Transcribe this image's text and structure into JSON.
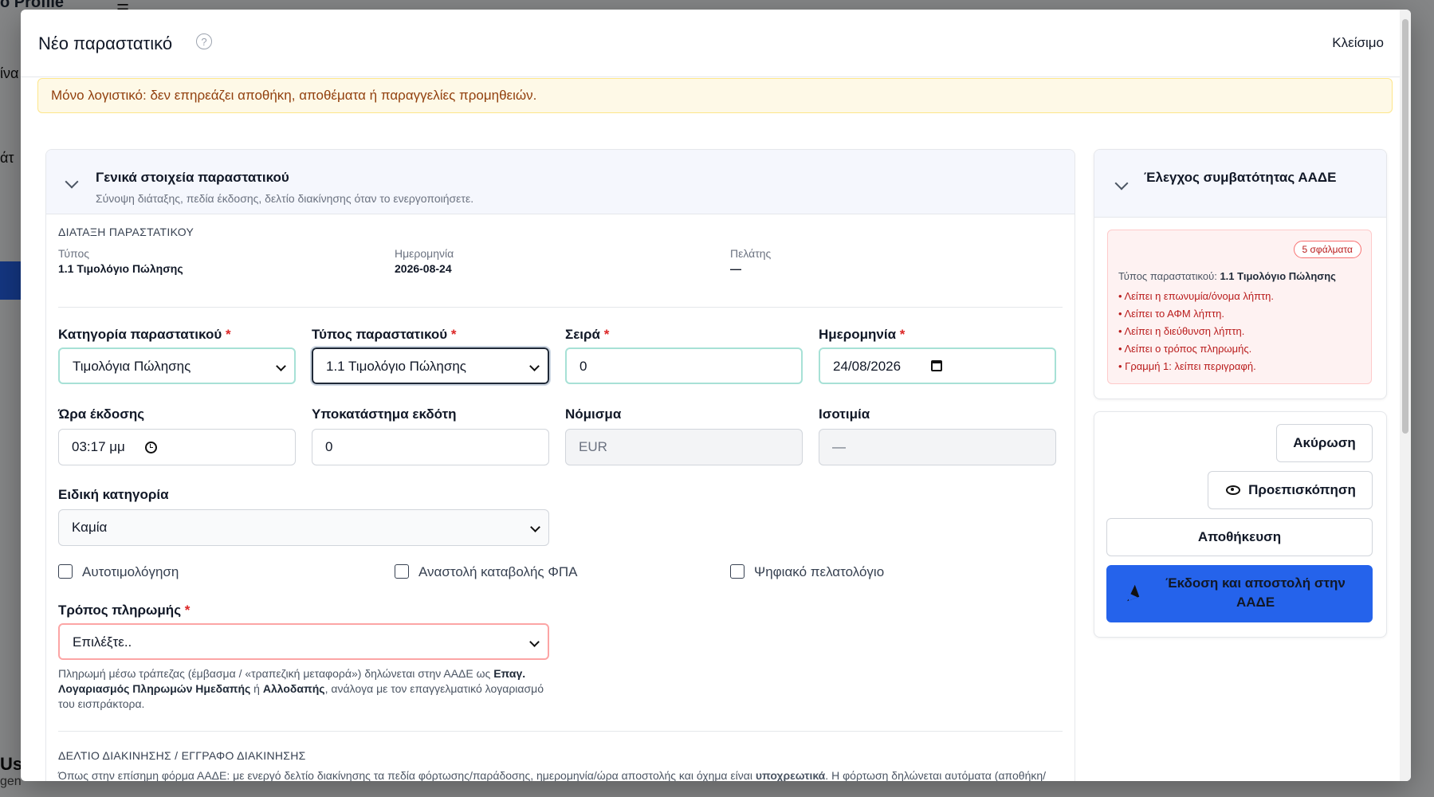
{
  "background": {
    "app_title": "o Profile",
    "sidebar_fragments": [
      "ίνα",
      "άτ"
    ],
    "bottom_user": "Use",
    "bottom_sub": "gen"
  },
  "modal": {
    "title": "Νέο παραστατικό",
    "help_icon": "?",
    "close_label": "Κλείσιμο",
    "alert_text": "Μόνο λογιστικό: δεν επηρεάζει αποθήκη, αποθέματα ή παραγγελίες προμηθειών."
  },
  "general": {
    "title": "Γενικά στοιχεία παραστατικού",
    "subtitle": "Σύνοψη διάταξης, πεδία έκδοσης, δελτίο διακίνησης όταν το ενεργοποιήσετε.",
    "section_label": "ΔΙΑΤΑΞΗ ΠΑΡΑΣΤΑΤΙΚΟΥ",
    "summary": {
      "type_label": "Τύπος",
      "type_value": "1.1 Τιμολόγιο Πώλησης",
      "date_label": "Ημερομηνία",
      "date_value": "2026-08-24",
      "customer_label": "Πελάτης",
      "customer_value": "—"
    },
    "fields": {
      "category_label": "Κατηγορία παραστατικού",
      "category_value": "Τιμολόγια Πώλησης",
      "doctype_label": "Τύπος παραστατικού",
      "doctype_value": "1.1 Τιμολόγιο Πώλησης",
      "series_label": "Σειρά",
      "series_value": "0",
      "date_label": "Ημερομηνία",
      "date_value": "24/08/2026",
      "time_label": "Ώρα έκδοσης",
      "time_value": "03:17 μμ",
      "branch_label": "Υποκατάστημα εκδότη",
      "branch_value": "0",
      "currency_label": "Νόμισμα",
      "currency_value": "EUR",
      "rate_label": "Ισοτιμία",
      "rate_value": "—",
      "special_label": "Ειδική κατηγορία",
      "special_value": "Καμία",
      "self_invoice_label": "Αυτοτιμολόγηση",
      "vat_suspend_label": "Αναστολή καταβολής ΦΠΑ",
      "digital_ledger_label": "Ψηφιακό πελατολόγιο",
      "payment_label": "Τρόπος πληρωμής",
      "payment_value": "Επιλέξτε..",
      "required_mark": "*"
    },
    "payment_help": {
      "part1": "Πληρωμή μέσω τράπεζας (έμβασμα / «τραπεζική μεταφορά») δηλώνεται στην ΑΑΔΕ ως ",
      "bold1": "Επαγ. Λογαριασμός Πληρωμών Ημεδαπής",
      "part2": " ή ",
      "bold2": "Αλλοδαπής",
      "part3": ", ανάλογα με τον επαγγελματικό λογαριασμό του εισπράκτορα."
    },
    "delivery": {
      "section_label": "ΔΕΛΤΙΟ ΔΙΑΚΙΝΗΣΗΣ / ΕΓΓΡΑΦΟ ΔΙΑΚΙΝΗΣΗΣ",
      "text1": "Όπως στην επίσημη φόρμα ΑΑΔΕ: με ενεργό δελτίο διακίνησης τα πεδία φόρτωσης/παράδοσης, ημερομηνία/ώρα αποστολής και όχημα είναι ",
      "bold": "υποχρεωτικά",
      "text2": ". Η φόρτωση δηλώνεται αυτόματα (αποθήκη/υποκατάστημα) όπου αυτό προκύπτει από την έδρα εταιρείας."
    }
  },
  "compliance": {
    "title": "Έλεγχος συμβατότητας ΑΑΔΕ",
    "badge": "5 σφάλματα",
    "type_prefix": "Τύπος παραστατικού: ",
    "type_value": "1.1 Τιμολόγιο Πώλησης",
    "errors": [
      "• Λείπει η επωνυμία/όνομα λήπτη.",
      "• Λείπει το ΑΦΜ λήπτη.",
      "• Λείπει η διεύθυνση λήπτη.",
      "• Λείπει ο τρόπος πληρωμής.",
      "• Γραμμή 1: λείπει περιγραφή."
    ]
  },
  "actions": {
    "cancel": "Ακύρωση",
    "preview": "Προεπισκόπηση",
    "save": "Αποθήκευση",
    "issue_send": "Έκδοση και αποστολή στην ΑΑΔΕ"
  },
  "colors": {
    "primary": "#2563eb",
    "alert_bg": "#fef9e7",
    "error": "#b91c1c",
    "teal_border": "#a7e1d6"
  }
}
